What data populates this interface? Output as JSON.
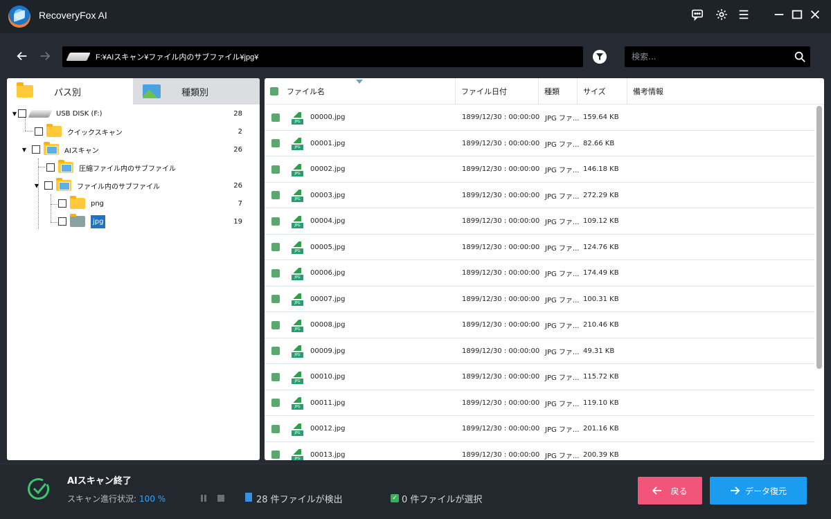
{
  "app": {
    "title": "RecoveryFox AI"
  },
  "nav": {
    "path": "F:¥AIスキャン¥ファイル内のサブファイル¥jpg¥",
    "search_placeholder": "検索..."
  },
  "left_panel": {
    "tabs": [
      {
        "label": "パス別",
        "active": true
      },
      {
        "label": "種類別",
        "active": false
      }
    ],
    "tree": [
      {
        "label": "USB DISK (F:)",
        "count": "28"
      },
      {
        "label": "クイックスキャン",
        "count": "2"
      },
      {
        "label": "AIスキャン",
        "count": "26"
      },
      {
        "label": "圧縮ファイル内のサブファイル",
        "count": ""
      },
      {
        "label": "ファイル内のサブファイル",
        "count": "26"
      },
      {
        "label": "png",
        "count": "7"
      },
      {
        "label": "jpg",
        "count": "19"
      }
    ]
  },
  "table": {
    "columns": [
      "ファイル名",
      "ファイル日付",
      "種類",
      "サイズ",
      "備考情報"
    ],
    "rows": [
      {
        "name": "00000.jpg",
        "date": "1899/12/30 : 00:00:00",
        "type": "JPG ファ...",
        "size": "159.64 KB"
      },
      {
        "name": "00001.jpg",
        "date": "1899/12/30 : 00:00:00",
        "type": "JPG ファ...",
        "size": "82.66 KB"
      },
      {
        "name": "00002.jpg",
        "date": "1899/12/30 : 00:00:00",
        "type": "JPG ファ...",
        "size": "146.18 KB"
      },
      {
        "name": "00003.jpg",
        "date": "1899/12/30 : 00:00:00",
        "type": "JPG ファ...",
        "size": "272.29 KB"
      },
      {
        "name": "00004.jpg",
        "date": "1899/12/30 : 00:00:00",
        "type": "JPG ファ...",
        "size": "109.12 KB"
      },
      {
        "name": "00005.jpg",
        "date": "1899/12/30 : 00:00:00",
        "type": "JPG ファ...",
        "size": "124.76 KB"
      },
      {
        "name": "00006.jpg",
        "date": "1899/12/30 : 00:00:00",
        "type": "JPG ファ...",
        "size": "174.49 KB"
      },
      {
        "name": "00007.jpg",
        "date": "1899/12/30 : 00:00:00",
        "type": "JPG ファ...",
        "size": "100.31 KB"
      },
      {
        "name": "00008.jpg",
        "date": "1899/12/30 : 00:00:00",
        "type": "JPG ファ...",
        "size": "210.46 KB"
      },
      {
        "name": "00009.jpg",
        "date": "1899/12/30 : 00:00:00",
        "type": "JPG ファ...",
        "size": "49.31 KB"
      },
      {
        "name": "00010.jpg",
        "date": "1899/12/30 : 00:00:00",
        "type": "JPG ファ...",
        "size": "115.72 KB"
      },
      {
        "name": "00011.jpg",
        "date": "1899/12/30 : 00:00:00",
        "type": "JPG ファ...",
        "size": "119.10 KB"
      },
      {
        "name": "00012.jpg",
        "date": "1899/12/30 : 00:00:00",
        "type": "JPG ファ...",
        "size": "201.16 KB"
      },
      {
        "name": "00013.jpg",
        "date": "1899/12/30 : 00:00:00",
        "type": "JPG ファ...",
        "size": "200.39 KB"
      }
    ]
  },
  "footer": {
    "status_title": "AIスキャン終了",
    "progress_label": "スキャン進行状況:",
    "progress_value": "100 %",
    "found_text": "28 件ファイルが検出",
    "selected_text": "0 件ファイルが選択",
    "back_label": "戻る",
    "recover_label": "データ復元"
  },
  "colors": {
    "accent": "#1a9cf0",
    "back_button": "#f2557a",
    "progress": "#2ea8ff",
    "status_icon": "#3ec46d"
  }
}
